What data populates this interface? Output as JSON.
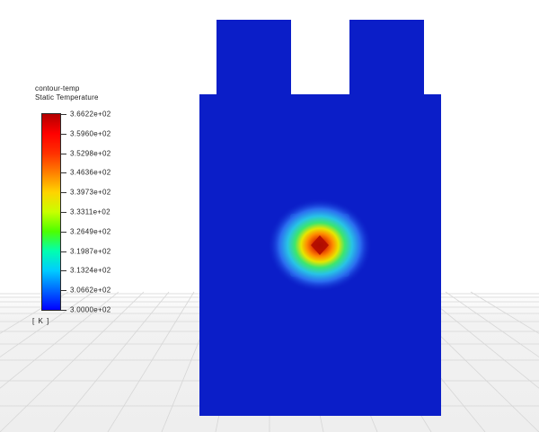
{
  "legend": {
    "name": "contour-temp",
    "quantity": "Static Temperature",
    "unit": "[ K ]",
    "colormap": [
      "#0000ff",
      "#0066ff",
      "#00ccff",
      "#00ffb0",
      "#4cff00",
      "#c8ff00",
      "#ffd400",
      "#ff8000",
      "#ff3000",
      "#ff0000",
      "#b30000"
    ],
    "tick_labels": [
      "3.6622e+02",
      "3.5960e+02",
      "3.5298e+02",
      "3.4636e+02",
      "3.3973e+02",
      "3.3311e+02",
      "3.2649e+02",
      "3.1987e+02",
      "3.1324e+02",
      "3.0662e+02",
      "3.0000e+02"
    ]
  },
  "contour": {
    "field_color": "#0b1ec8",
    "hotspot_colors": [
      "#c11a00",
      "#ff7a00",
      "#f0e600",
      "#32e664",
      "#25c4e4",
      "#1f6ff0"
    ]
  }
}
